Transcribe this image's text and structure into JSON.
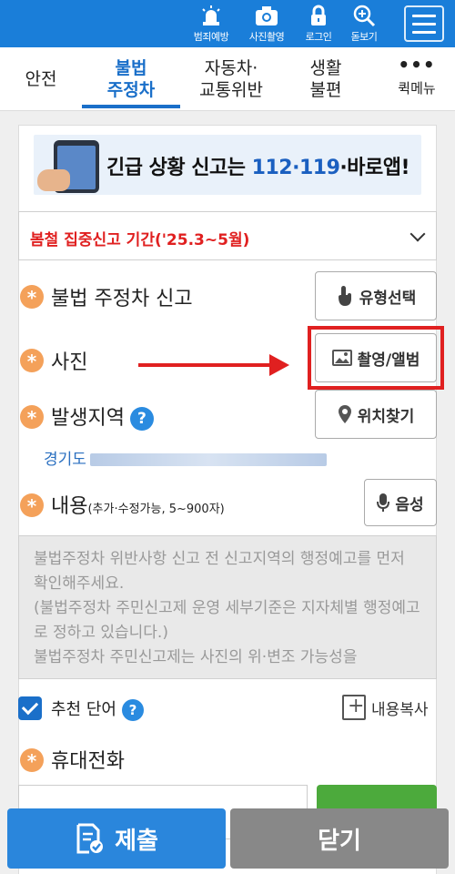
{
  "topbar": {
    "items": [
      {
        "label": "범죄예방",
        "icon": "siren-icon"
      },
      {
        "label": "사진촬영",
        "icon": "camera-icon"
      },
      {
        "label": "로그인",
        "icon": "lock-icon"
      },
      {
        "label": "돋보기",
        "icon": "magnifier-plus-icon"
      }
    ],
    "menu_icon": "hamburger-icon",
    "color": "#1a7ed9"
  },
  "tabs": [
    {
      "label": "안전",
      "active": false
    },
    {
      "label": "불법\n주정차",
      "active": true
    },
    {
      "label": "자동차·\n교통위반",
      "active": false
    },
    {
      "label": "생활\n불편",
      "active": false
    }
  ],
  "quick_menu": {
    "dots": "•••",
    "label": "퀵메뉴"
  },
  "banner": {
    "prefix": "긴급 상황 신고는 ",
    "numbers": "112·119",
    "suffix": "·바로앱!"
  },
  "notice": {
    "text": "봄철 집중신고 기간('25.3~5월)"
  },
  "form": {
    "report_type": {
      "label": "불법 주정차 신고",
      "button": "유형선택"
    },
    "photo": {
      "label": "사진",
      "button": "촬영/앨범"
    },
    "location": {
      "label": "발생지역",
      "help": "?",
      "button": "위치찾기",
      "address": "경기도"
    },
    "content": {
      "label": "내용",
      "hint": "(추가·수정가능, 5~900자)",
      "button": "음성",
      "placeholder": "불법주정차 위반사항 신고 전 신고지역의 행정예고를 먼저 확인해주세요.\n(불법주정차 주민신고제 운영 세부기준은 지자체별 행정예고로 정하고 있습니다.)\n불법주정차 주민신고제는 사진의 위·변조 가능성을"
    },
    "recommend": {
      "label": "추천 단어",
      "help": "?",
      "checked": true,
      "copy": "내용복사"
    },
    "phone": {
      "label": "휴대전화"
    }
  },
  "footer": {
    "submit": "제출",
    "close": "닫기"
  },
  "colors": {
    "accent": "#1a6fc9",
    "alert": "#e02020",
    "required": "#f4a15a"
  }
}
